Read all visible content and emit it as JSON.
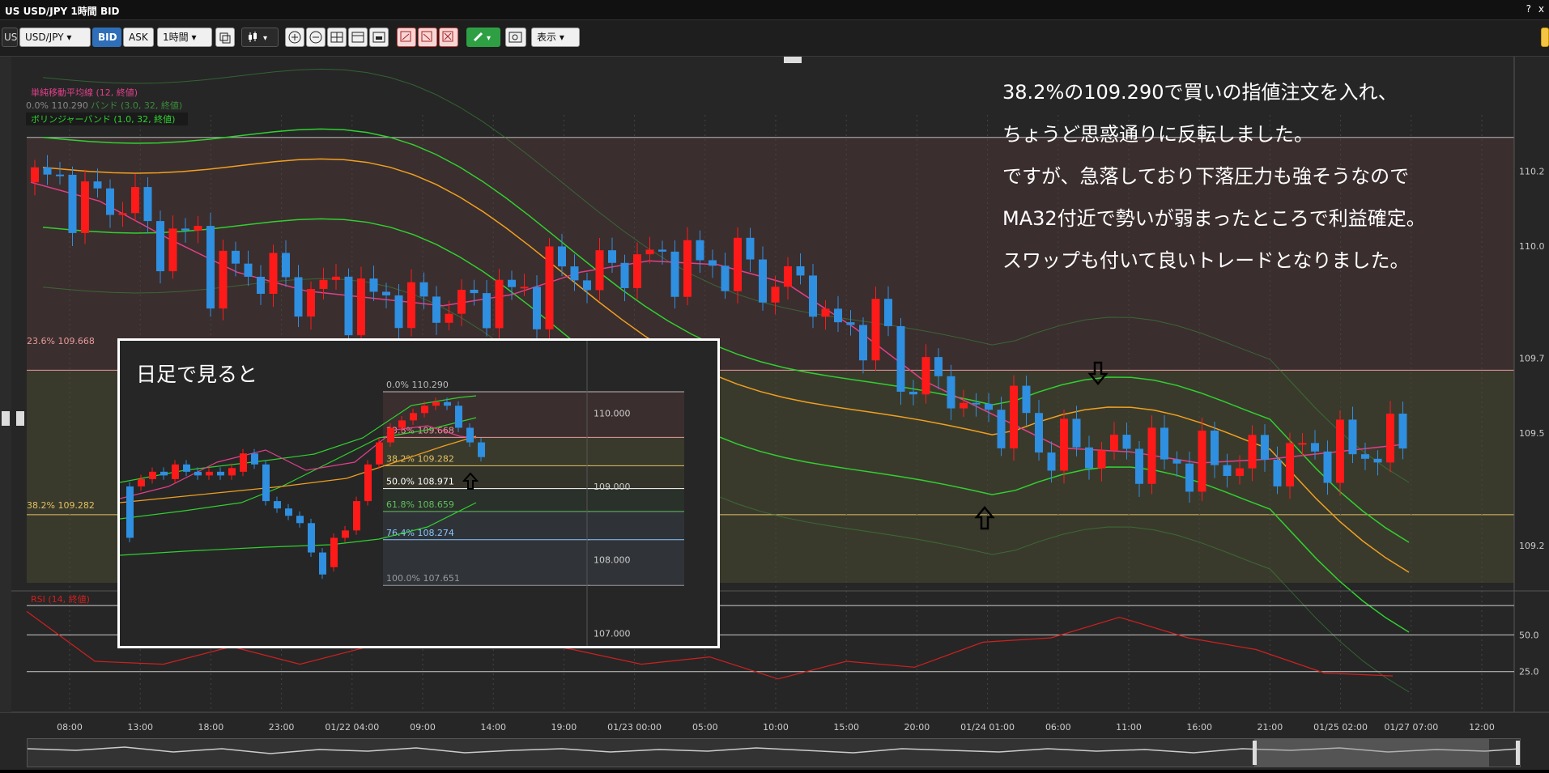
{
  "window": {
    "title": "US USD/JPY 1時間 BID",
    "help_label": "?",
    "close_label": "x"
  },
  "toolbar": {
    "symbol_left_label": "US",
    "symbol": "USD/JPY",
    "bid_label": "BID",
    "ask_label": "ASK",
    "timeframe": "1時間",
    "view_label": "表示"
  },
  "icons": {
    "candle_type": "candlestick-icon",
    "zoom_in": "zoom-in-icon",
    "zoom_out": "zoom-out-icon",
    "pen": "pen-icon",
    "screenshot": "screenshot-icon"
  },
  "legend": {
    "sma": "単純移動平均線 (12, 終値)",
    "fib0": "0.0% 110.290",
    "boll_ghost": "バンド (3.0, 32, 終値)",
    "boll": "ボリンジャーバンド (1.0, 32, 終値)",
    "rsi": "RSI (14, 終値)"
  },
  "fib_labels": {
    "f236": "23.6% 109.668",
    "f382": "38.2% 109.282"
  },
  "price_axis": [
    "110.2",
    "110.0",
    "109.7",
    "109.5",
    "109.2"
  ],
  "rsi_axis": [
    "50.0",
    "25.0"
  ],
  "time_axis": [
    "08:00",
    "13:00",
    "18:00",
    "23:00",
    "01/22 04:00",
    "09:00",
    "14:00",
    "19:00",
    "01/23 00:00",
    "05:00",
    "10:00",
    "15:00",
    "20:00",
    "01/24 01:00",
    "06:00",
    "11:00",
    "16:00",
    "21:00",
    "01/25 02:00",
    "01/27 07:00",
    "12:00"
  ],
  "annotation": [
    "38.2%の109.290で買いの指値注文を入れ、",
    "ちょうど思惑通りに反転しました。",
    "ですが、急落しており下落圧力も強そうなので",
    "MA32付近で勢いが弱まったところで利益確定。",
    "スワップも付いて良いトレードとなりました。"
  ],
  "inset": {
    "title": "日足で見ると",
    "fib_labels": [
      "0.0% 110.290",
      "23.6% 109.668",
      "38.2% 109.282",
      "50.0% 108.971",
      "61.8% 108.659",
      "76.4% 108.274",
      "100.0% 107.651"
    ],
    "price_axis": [
      "110.000",
      "109.000",
      "108.000",
      "107.000"
    ]
  },
  "colors": {
    "up": "#ff1a1a",
    "down": "#2f8fe0",
    "sma": "#e0408a",
    "ma32": "#f0a020",
    "boll": "#30d030",
    "rsi": "#d02020"
  },
  "chart_data": {
    "type": "line",
    "title": "",
    "series": [
      {
        "name": "単純移動平均線 (12, 終値)",
        "values": [
          110.17,
          110.12,
          110.02,
          109.93,
          109.88,
          109.86,
          109.84,
          109.87,
          109.93,
          109.96,
          109.95,
          109.9,
          109.78,
          109.64,
          109.55,
          109.46,
          109.45,
          109.42,
          109.43,
          109.45,
          109.47
        ]
      },
      {
        "name": "RSI (14, 終値)",
        "values": [
          66,
          32,
          30,
          42,
          30,
          42,
          58,
          48,
          40,
          30,
          35,
          20,
          32,
          28,
          45,
          48,
          62,
          48,
          40,
          24,
          22
        ]
      }
    ],
    "xlabel": "",
    "ylabel": "",
    "ylim": [
      109.1,
      110.35
    ]
  }
}
